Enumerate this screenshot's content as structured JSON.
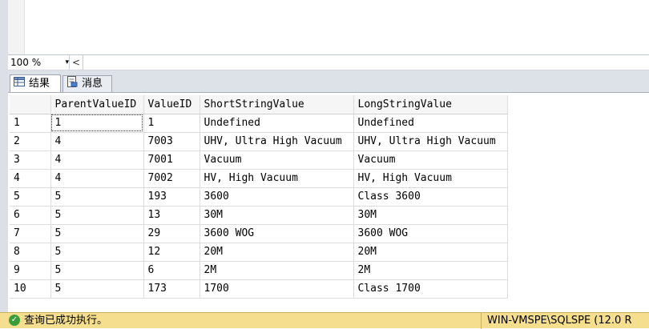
{
  "zoom": {
    "value": "100 %",
    "arrow": "▾",
    "scroll_left": "<"
  },
  "tabs": [
    {
      "label": "结果",
      "icon": "grid-icon"
    },
    {
      "label": "消息",
      "icon": "message-icon"
    }
  ],
  "grid": {
    "columns": [
      "ParentValueID",
      "ValueID",
      "ShortStringValue",
      "LongStringValue"
    ],
    "rows": [
      {
        "num": "1",
        "cells": [
          "1",
          "1",
          "Undefined",
          "Undefined"
        ]
      },
      {
        "num": "2",
        "cells": [
          "4",
          "7003",
          "UHV, Ultra High Vacuum",
          "UHV, Ultra High Vacuum"
        ]
      },
      {
        "num": "3",
        "cells": [
          "4",
          "7001",
          "Vacuum",
          "Vacuum"
        ]
      },
      {
        "num": "4",
        "cells": [
          "4",
          "7002",
          "HV, High Vacuum",
          "HV, High Vacuum"
        ]
      },
      {
        "num": "5",
        "cells": [
          "5",
          "193",
          "3600",
          "Class 3600"
        ]
      },
      {
        "num": "6",
        "cells": [
          "5",
          "13",
          "30M",
          "30M"
        ]
      },
      {
        "num": "7",
        "cells": [
          "5",
          "29",
          "3600 WOG",
          "3600 WOG"
        ]
      },
      {
        "num": "8",
        "cells": [
          "5",
          "12",
          "20M",
          "20M"
        ]
      },
      {
        "num": "9",
        "cells": [
          "5",
          "6",
          "2M",
          "2M"
        ]
      },
      {
        "num": "10",
        "cells": [
          "5",
          "173",
          "1700",
          "Class 1700"
        ]
      }
    ]
  },
  "status": {
    "message": "查询已成功执行。",
    "server": "WIN-VMSPE\\SQLSPE (12.0 R",
    "icon": "success-check-icon",
    "color": "#f5df8e"
  }
}
